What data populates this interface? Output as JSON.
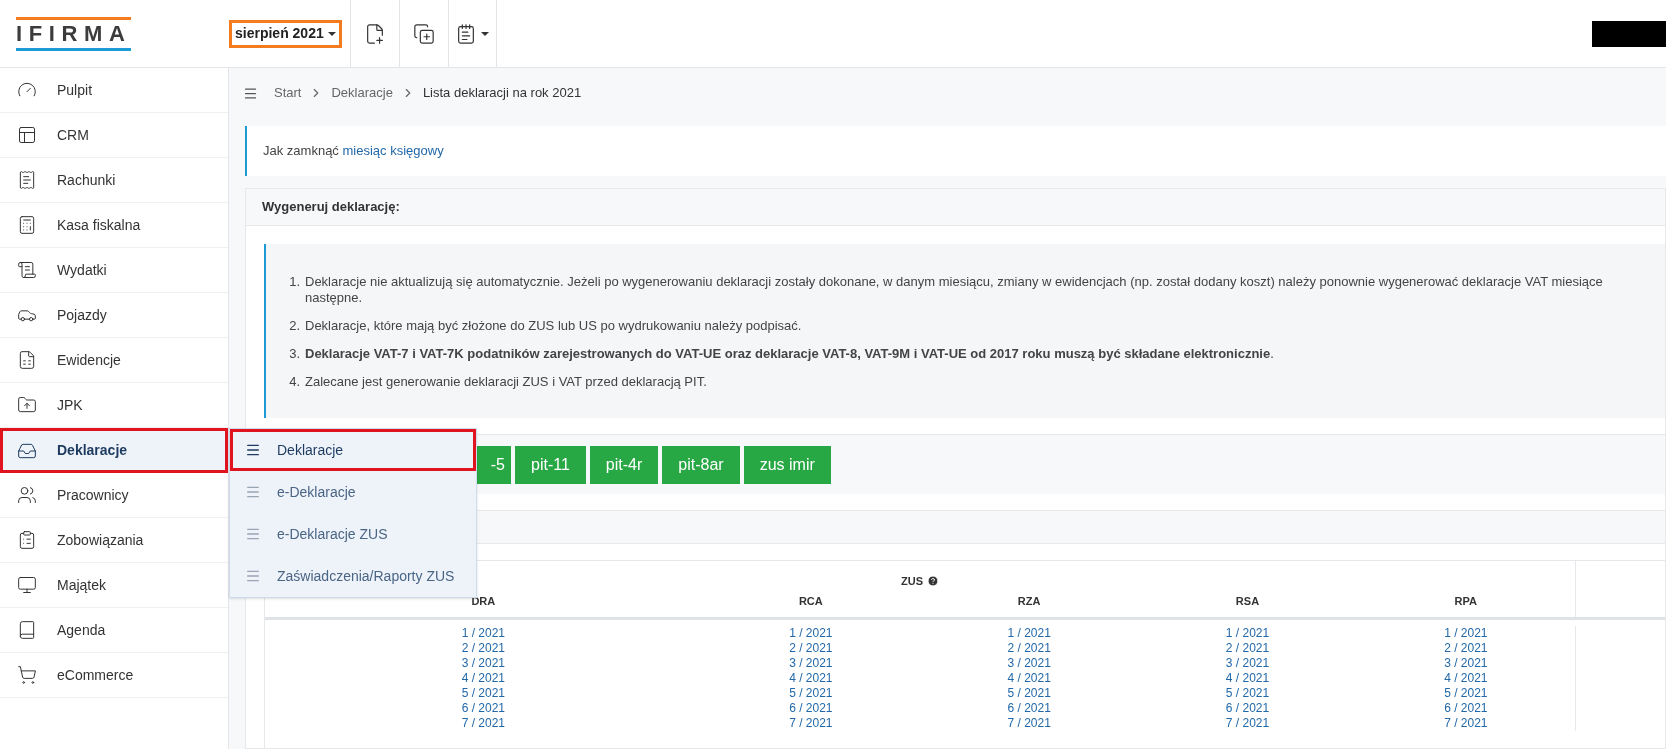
{
  "header": {
    "logo": "IFIRMA",
    "period": "sierpień 2021"
  },
  "sidebar": {
    "items": [
      {
        "label": "Pulpit",
        "selected": false
      },
      {
        "label": "CRM",
        "selected": false
      },
      {
        "label": "Rachunki",
        "selected": false
      },
      {
        "label": "Kasa fiskalna",
        "selected": false
      },
      {
        "label": "Wydatki",
        "selected": false
      },
      {
        "label": "Pojazdy",
        "selected": false
      },
      {
        "label": "Ewidencje",
        "selected": false
      },
      {
        "label": "JPK",
        "selected": false
      },
      {
        "label": "Deklaracje",
        "selected": true
      },
      {
        "label": "Pracownicy",
        "selected": false
      },
      {
        "label": "Zobowiązania",
        "selected": false
      },
      {
        "label": "Majątek",
        "selected": false
      },
      {
        "label": "Agenda",
        "selected": false
      },
      {
        "label": "eCommerce",
        "selected": false
      }
    ]
  },
  "submenu": {
    "items": [
      {
        "label": "Deklaracje",
        "selected": true
      },
      {
        "label": "e-Deklaracje",
        "selected": false
      },
      {
        "label": "e-Deklaracje ZUS",
        "selected": false
      },
      {
        "label": "Zaświadczenia/Raporty ZUS",
        "selected": false
      }
    ]
  },
  "breadcrumb": [
    "Start",
    "Deklaracje",
    "Lista deklaracji na rok 2021"
  ],
  "info": {
    "text": "Jak zamknąć",
    "link": "miesiąc księgowy"
  },
  "generate": {
    "title": "Wygeneruj deklarację:",
    "notes": [
      {
        "number": "1.",
        "text": "Deklaracje nie aktualizują się automatycznie. Jeżeli po wygenerowaniu deklaracji zostały dokonane, w danym miesiącu, zmiany w ewidencjach (np. został dodany koszt) należy ponownie wygenerować deklaracje VAT miesiące następne."
      },
      {
        "number": "2.",
        "text": "Deklaracje, które mają być złożone do ZUS lub US po wydrukowaniu należy podpisać."
      },
      {
        "number": "3.",
        "text": "**Deklaracje VAT-7 i VAT-7K podatników zarejestrowanych do VAT-UE oraz deklaracje VAT-8, VAT-9M i VAT-UE od 2017 roku muszą być składane elektronicznie**."
      },
      {
        "number": "4.",
        "text": "Zalecane jest generowanie deklaracji ZUS i VAT przed deklaracją PIT."
      }
    ],
    "buttons": [
      "-5",
      "pit-11",
      "pit-4r",
      "pit-8ar",
      "zus imir"
    ]
  },
  "zus_table": {
    "group": "ZUS",
    "columns": [
      "DRA",
      "RCA",
      "RZA",
      "RSA",
      "RPA"
    ],
    "rows": [
      [
        "1 / 2021",
        "1 / 2021",
        "1 / 2021",
        "1 / 2021",
        "1 / 2021"
      ],
      [
        "2 / 2021",
        "2 / 2021",
        "2 / 2021",
        "2 / 2021",
        "2 / 2021"
      ],
      [
        "3 / 2021",
        "3 / 2021",
        "3 / 2021",
        "3 / 2021",
        "3 / 2021"
      ],
      [
        "4 / 2021",
        "4 / 2021",
        "4 / 2021",
        "4 / 2021",
        "4 / 2021"
      ],
      [
        "5 / 2021",
        "5 / 2021",
        "5 / 2021",
        "5 / 2021",
        "5 / 2021"
      ],
      [
        "6 / 2021",
        "6 / 2021",
        "6 / 2021",
        "6 / 2021",
        "6 / 2021"
      ],
      [
        "7 / 2021",
        "7 / 2021",
        "7 / 2021",
        "7 / 2021",
        "7 / 2021"
      ]
    ]
  }
}
